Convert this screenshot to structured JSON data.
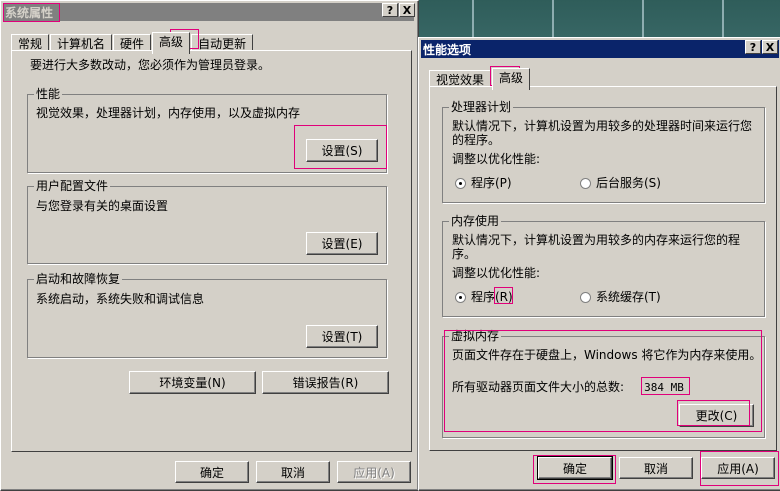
{
  "sysprops": {
    "title": "系统属性",
    "help": "?",
    "close": "X",
    "tabs": [
      "常规",
      "计算机名",
      "硬件",
      "高级",
      "自动更新"
    ],
    "admin_note": "要进行大多数改动，您必须作为管理员登录。",
    "performance": {
      "title": "性能",
      "desc": "视觉效果，处理器计划，内存使用，以及虚拟内存",
      "button": "设置(S)"
    },
    "profiles": {
      "title": "用户配置文件",
      "desc": "与您登录有关的桌面设置",
      "button": "设置(E)"
    },
    "startup": {
      "title": "启动和故障恢复",
      "desc": "系统启动，系统失败和调试信息",
      "button": "设置(T)"
    },
    "env_button": "环境变量(N)",
    "error_button": "错误报告(R)",
    "ok": "确定",
    "cancel": "取消",
    "apply": "应用(A)"
  },
  "perf": {
    "title": "性能选项",
    "help": "?",
    "close": "X",
    "tabs": [
      "视觉效果",
      "高级"
    ],
    "cpu": {
      "title": "处理器计划",
      "desc": "默认情况下，计算机设置为用较多的处理器时间来运行您的程序。",
      "adjust": "调整以优化性能:",
      "opt1": "程序(P)",
      "opt2": "后台服务(S)"
    },
    "mem": {
      "title": "内存使用",
      "desc": "默认情况下，计算机设置为用较多的内存来运行您的程序。",
      "adjust": "调整以优化性能:",
      "opt1": "程序(R)",
      "opt2": "系统缓存(T)"
    },
    "vm": {
      "title": "虚拟内存",
      "desc": "页面文件存在于硬盘上，Windows 将它作为内存来使用。",
      "total_label": "所有驱动器页面文件大小的总数:",
      "total_value": "384 MB",
      "change": "更改(C)"
    },
    "ok": "确定",
    "cancel": "取消",
    "apply": "应用(A)"
  },
  "colors": {
    "highlight": "#e0007a",
    "active_title": "#0a246a",
    "inactive_title": "#808080",
    "face": "#d4d0c8"
  }
}
